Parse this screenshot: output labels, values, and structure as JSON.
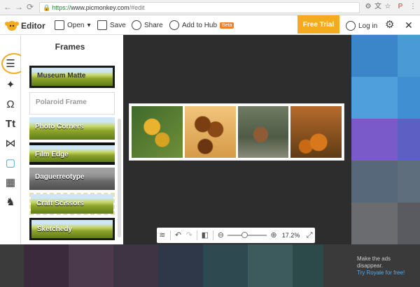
{
  "browser": {
    "url_secure_label": "https://",
    "url_domain": "www.picmonkey.com",
    "url_path": "/#edit"
  },
  "header": {
    "app_name": "Editor",
    "open_label": "Open",
    "save_label": "Save",
    "share_label": "Share",
    "add_to_hub_label": "Add to Hub",
    "beta_badge": "Beta",
    "free_trial_label": "Free Trial",
    "login_label": "Log in"
  },
  "tools": {
    "icons": [
      "sliders-icon",
      "magic-wand-icon",
      "face-icon",
      "text-icon",
      "butterfly-icon",
      "frame-icon",
      "texture-icon",
      "cat-icon"
    ]
  },
  "frames_panel": {
    "title": "Frames",
    "items": [
      {
        "label": "Museum Matte"
      },
      {
        "label": "Polaroid Frame"
      },
      {
        "label": "Photo Corners"
      },
      {
        "label": "Film Edge"
      },
      {
        "label": "Daguerreotype"
      },
      {
        "label": "Craft Scissors"
      },
      {
        "label": "Sketchedy"
      }
    ]
  },
  "zoom": {
    "value_text": "17.2%",
    "level": 0.172
  },
  "ads": {
    "line1": "Make the ads disappear.",
    "link": "Try Royale for free!"
  },
  "colors": {
    "accent": "#f5ab1e",
    "ad_blue_1": "#3f8fd2",
    "ad_blue_2": "#4aa0de",
    "ad_purple": "#7e5bd1",
    "ad_gray": "#5f6e7c"
  }
}
